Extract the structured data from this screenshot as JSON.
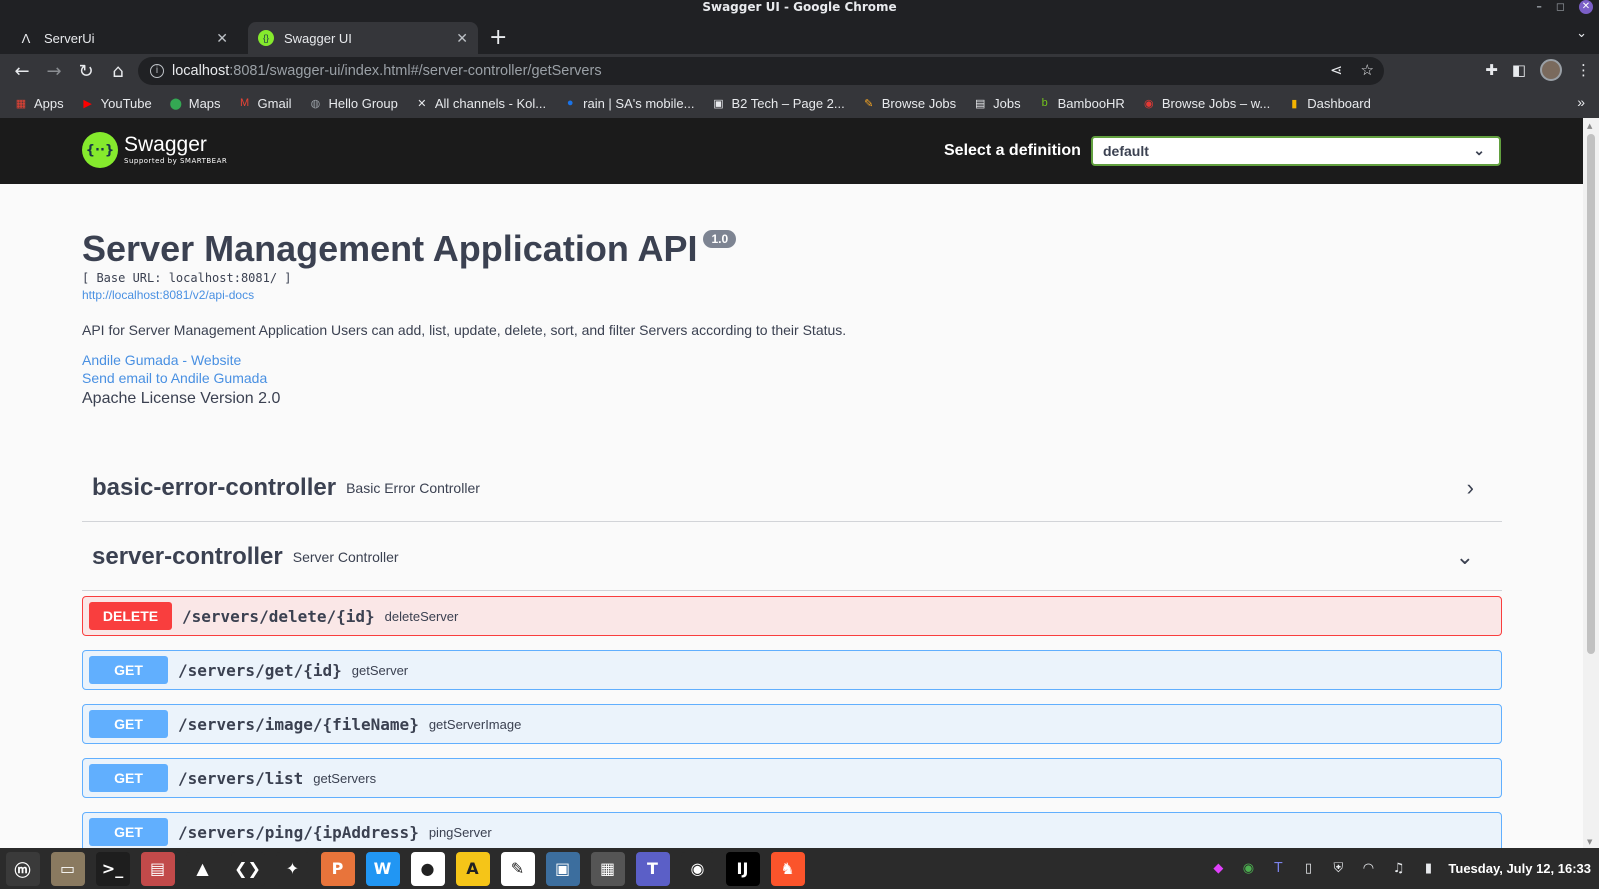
{
  "window": {
    "title": "Swagger UI - Google Chrome"
  },
  "tabs": [
    {
      "label": "ServerUi",
      "icon": "angular-icon"
    },
    {
      "label": "Swagger UI",
      "icon": "swagger-icon"
    }
  ],
  "omnibox": {
    "host": "localhost",
    "rest": ":8081/swagger-ui/index.html#/server-controller/getServers"
  },
  "bookmarks": [
    {
      "label": "Apps",
      "icon": "apps-grid-icon",
      "color": "#ea4335"
    },
    {
      "label": "YouTube",
      "icon": "youtube-icon",
      "color": "#ff0000"
    },
    {
      "label": "Maps",
      "icon": "maps-icon",
      "color": "#34a853"
    },
    {
      "label": "Gmail",
      "icon": "gmail-icon",
      "color": "#ea4335"
    },
    {
      "label": "Hello Group",
      "icon": "globe-icon",
      "color": "#9aa0a6"
    },
    {
      "label": "All channels - Kol...",
      "icon": "x-icon",
      "color": "#e8eaed"
    },
    {
      "label": "rain | SA's mobile...",
      "icon": "rain-icon",
      "color": "#1a73e8"
    },
    {
      "label": "B2 Tech – Page 2...",
      "icon": "b2-icon",
      "color": "#e8eaed"
    },
    {
      "label": "Browse Jobs",
      "icon": "pencil-icon",
      "color": "#f6a623"
    },
    {
      "label": "Jobs",
      "icon": "doc-icon",
      "color": "#e8eaed"
    },
    {
      "label": "BambooHR",
      "icon": "bamboo-icon",
      "color": "#73c41d"
    },
    {
      "label": "Browse Jobs – w...",
      "icon": "jobs-icon",
      "color": "#e53935"
    },
    {
      "label": "Dashboard",
      "icon": "dashboard-icon",
      "color": "#f4b400"
    }
  ],
  "swagger": {
    "logo_name": "Swagger",
    "logo_sub": "Supported by SMARTBEAR",
    "definition_label": "Select a definition",
    "definition_value": "default"
  },
  "info": {
    "title": "Server Management Application API",
    "version": "1.0",
    "base_url": "[ Base URL: localhost:8081/ ]",
    "docs_link": "http://localhost:8081/v2/api-docs",
    "description": "API for Server Management Application Users can add, list, update, delete, sort, and filter Servers according to their Status.",
    "contact_website": "Andile Gumada - Website",
    "contact_email": "Send email to Andile Gumada",
    "license": "Apache License Version 2.0"
  },
  "tags": [
    {
      "name": "basic-error-controller",
      "description": "Basic Error Controller",
      "expanded": false
    },
    {
      "name": "server-controller",
      "description": "Server Controller",
      "expanded": true
    }
  ],
  "operations": [
    {
      "method": "DELETE",
      "path": "/servers/delete/{id}",
      "operation_id": "deleteServer"
    },
    {
      "method": "GET",
      "path": "/servers/get/{id}",
      "operation_id": "getServer"
    },
    {
      "method": "GET",
      "path": "/servers/image/{fileName}",
      "operation_id": "getServerImage"
    },
    {
      "method": "GET",
      "path": "/servers/list",
      "operation_id": "getServers"
    },
    {
      "method": "GET",
      "path": "/servers/ping/{ipAddress}",
      "operation_id": "pingServer"
    }
  ],
  "taskbar": {
    "apps": [
      {
        "name": "mint-menu",
        "color": "#3a3a3a",
        "glyph": "ⓜ"
      },
      {
        "name": "files",
        "color": "#8a7a60",
        "glyph": "▭"
      },
      {
        "name": "terminal",
        "color": "#1e1e1e",
        "glyph": ">_"
      },
      {
        "name": "notes",
        "color": "#c24a4a",
        "glyph": "▤"
      },
      {
        "name": "vlc",
        "color": "#2b2b2b",
        "glyph": "▲"
      },
      {
        "name": "vscode",
        "color": "#2b2b2b",
        "glyph": "❮❯"
      },
      {
        "name": "mysql-workbench",
        "color": "#2b2b2b",
        "glyph": "✦"
      },
      {
        "name": "presentation",
        "color": "#e8743b",
        "glyph": "P"
      },
      {
        "name": "writer",
        "color": "#2196f3",
        "glyph": "W"
      },
      {
        "name": "mongodb-compass",
        "color": "#ffffff",
        "glyph": "●"
      },
      {
        "name": "app-yellow",
        "color": "#f5c518",
        "glyph": "A"
      },
      {
        "name": "pdf-reader",
        "color": "#ffffff",
        "glyph": "✎"
      },
      {
        "name": "screenshot",
        "color": "#3c6e9e",
        "glyph": "▣"
      },
      {
        "name": "calculator",
        "color": "#555555",
        "glyph": "▦"
      },
      {
        "name": "teams",
        "color": "#5b5fc7",
        "glyph": "T"
      },
      {
        "name": "chrome",
        "color": "#2b2b2b",
        "glyph": "◉"
      },
      {
        "name": "intellij",
        "color": "#000000",
        "glyph": "IJ"
      },
      {
        "name": "brave",
        "color": "#fb542b",
        "glyph": "♞"
      }
    ],
    "clock": "Tuesday, July 12, 16:33"
  }
}
